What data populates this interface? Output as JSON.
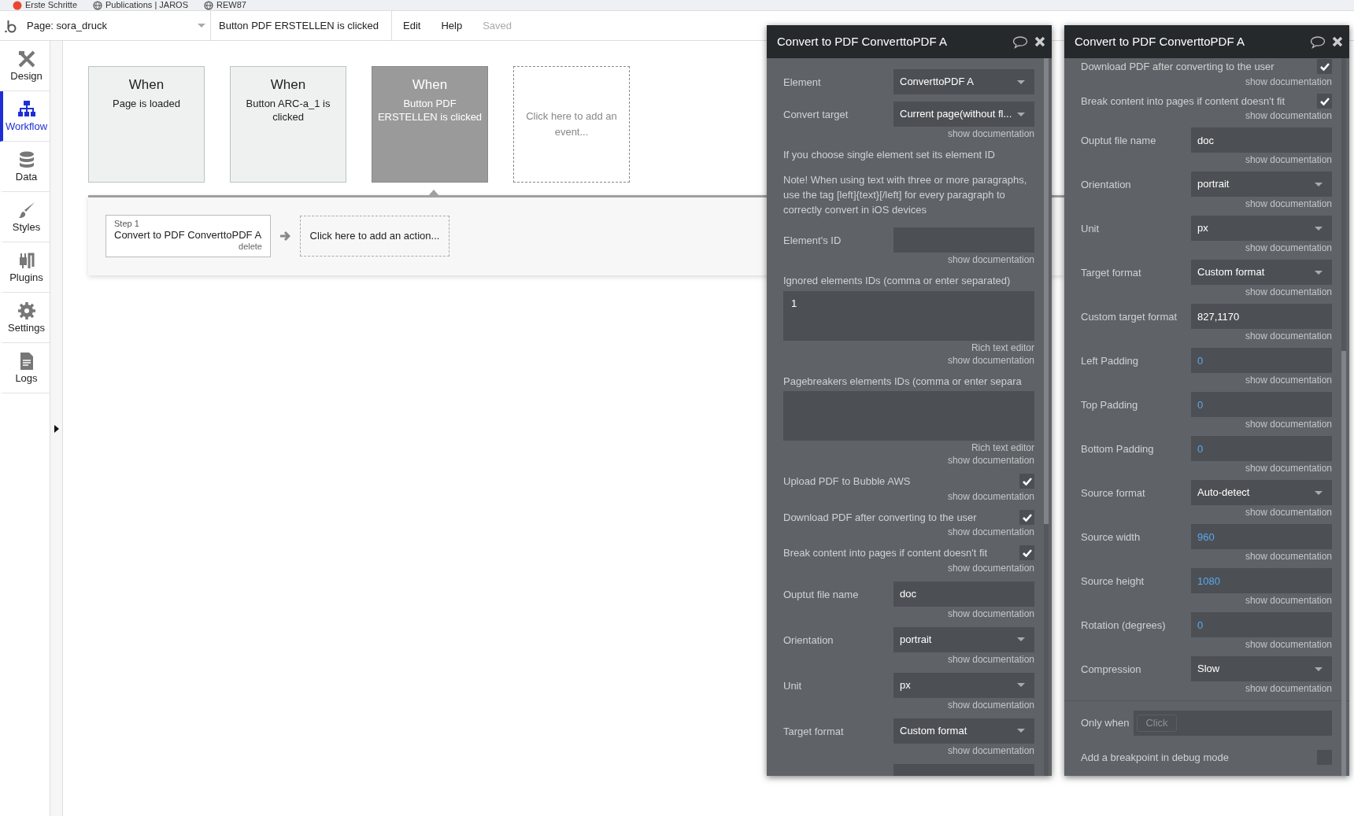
{
  "bookmarks": [
    {
      "label": "Erste Schritte",
      "kind": "app"
    },
    {
      "label": "Publications | JAROS",
      "kind": "globe"
    },
    {
      "label": "REW87",
      "kind": "globe"
    }
  ],
  "header": {
    "page": "Page: sora_druck",
    "event": "Button PDF ERSTELLEN is clicked",
    "menu": [
      "Edit",
      "Help"
    ],
    "status": "Saved"
  },
  "sidebar": [
    {
      "label": "Design",
      "selected": false
    },
    {
      "label": "Workflow",
      "selected": true
    },
    {
      "label": "Data",
      "selected": false
    },
    {
      "label": "Styles",
      "selected": false
    },
    {
      "label": "Plugins",
      "selected": false
    },
    {
      "label": "Settings",
      "selected": false
    },
    {
      "label": "Logs",
      "selected": false
    }
  ],
  "events": [
    {
      "kind": "event",
      "title": "When",
      "label": "Page is loaded",
      "selected": false
    },
    {
      "kind": "event",
      "title": "When",
      "label": "Button ARC-a_1 is clicked",
      "selected": false
    },
    {
      "kind": "event",
      "title": "When",
      "label": "Button PDF ERSTELLEN is clicked",
      "selected": true
    },
    {
      "kind": "add",
      "label": "Click here to add an event..."
    }
  ],
  "actions": [
    {
      "kind": "step",
      "step": "Step 1",
      "label": "Convert to PDF ConverttoPDF A",
      "delete": "delete"
    },
    {
      "kind": "add",
      "label": "Click here to add an action..."
    }
  ],
  "panels": [
    {
      "title": "Convert to PDF ConverttoPDF A",
      "scrolled": false,
      "rows": [
        {
          "kind": "select",
          "label": "Element",
          "value": "ConverttoPDF A"
        },
        {
          "kind": "select",
          "label": "Convert target",
          "value": "Current page(without fl...",
          "doc": "show documentation"
        },
        {
          "kind": "text",
          "text": "If you choose single element set its element ID"
        },
        {
          "kind": "text",
          "text": "Note! When using text with three or more paragraphs, use the tag [left]{text}[/left] for every paragraph to correctly convert in iOS devices"
        },
        {
          "kind": "input",
          "label": "Element's ID",
          "value": "",
          "doc": "show documentation"
        },
        {
          "kind": "textarea",
          "label": "Ignored elements IDs (comma or enter separated)",
          "value": "1",
          "editor": "Rich text editor",
          "doc": "show documentation"
        },
        {
          "kind": "textarea",
          "label": "Pagebreakers elements IDs (comma or enter separa",
          "value": "",
          "editor": "Rich text editor",
          "doc": "show documentation"
        },
        {
          "kind": "check",
          "label": "Upload PDF to Bubble AWS",
          "checked": true,
          "doc": "show documentation"
        },
        {
          "kind": "check",
          "label": "Download PDF after converting to the user",
          "checked": true,
          "doc": "show documentation"
        },
        {
          "kind": "check",
          "label": "Break content into pages if content doesn't fit",
          "checked": true,
          "doc": "show documentation"
        },
        {
          "kind": "input",
          "label": "Ouptut file name",
          "value": "doc",
          "doc": "show documentation"
        },
        {
          "kind": "select",
          "label": "Orientation",
          "value": "portrait",
          "doc": "show documentation"
        },
        {
          "kind": "select",
          "label": "Unit",
          "value": "px",
          "doc": "show documentation"
        },
        {
          "kind": "select",
          "label": "Target format",
          "value": "Custom format",
          "doc": "show documentation"
        },
        {
          "kind": "input",
          "label": "",
          "value": ""
        }
      ]
    },
    {
      "title": "Convert to PDF ConverttoPDF A",
      "scrolled": true,
      "rows": [
        {
          "kind": "check",
          "label": "Download PDF after converting to the user",
          "checked": true,
          "doc": "show documentation"
        },
        {
          "kind": "check",
          "label": "Break content into pages if content doesn't fit",
          "checked": true,
          "doc": "show documentation"
        },
        {
          "kind": "input",
          "label": "Ouptut file name",
          "value": "doc",
          "doc": "show documentation"
        },
        {
          "kind": "select",
          "label": "Orientation",
          "value": "portrait",
          "doc": "show documentation"
        },
        {
          "kind": "select",
          "label": "Unit",
          "value": "px",
          "doc": "show documentation"
        },
        {
          "kind": "select",
          "label": "Target format",
          "value": "Custom format",
          "doc": "show documentation"
        },
        {
          "kind": "input",
          "label": "Custom target format",
          "value": "827,1170",
          "doc": "show documentation"
        },
        {
          "kind": "number",
          "label": "Left Padding",
          "value": "0",
          "doc": "show documentation"
        },
        {
          "kind": "number",
          "label": "Top Padding",
          "value": "0",
          "doc": "show documentation"
        },
        {
          "kind": "number",
          "label": "Bottom Padding",
          "value": "0",
          "doc": "show documentation"
        },
        {
          "kind": "select",
          "label": "Source format",
          "value": "Auto-detect",
          "doc": "show documentation"
        },
        {
          "kind": "number",
          "label": "Source width",
          "value": "960",
          "doc": "show documentation"
        },
        {
          "kind": "number",
          "label": "Source height",
          "value": "1080",
          "doc": "show documentation"
        },
        {
          "kind": "number",
          "label": "Rotation (degrees)",
          "value": "0",
          "doc": "show documentation"
        },
        {
          "kind": "select",
          "label": "Compression",
          "value": "Slow",
          "doc": "show documentation"
        }
      ],
      "condition": {
        "label": "Only when",
        "action": "Click"
      },
      "breakpoint": {
        "label": "Add a breakpoint in debug mode",
        "checked": false
      }
    }
  ]
}
